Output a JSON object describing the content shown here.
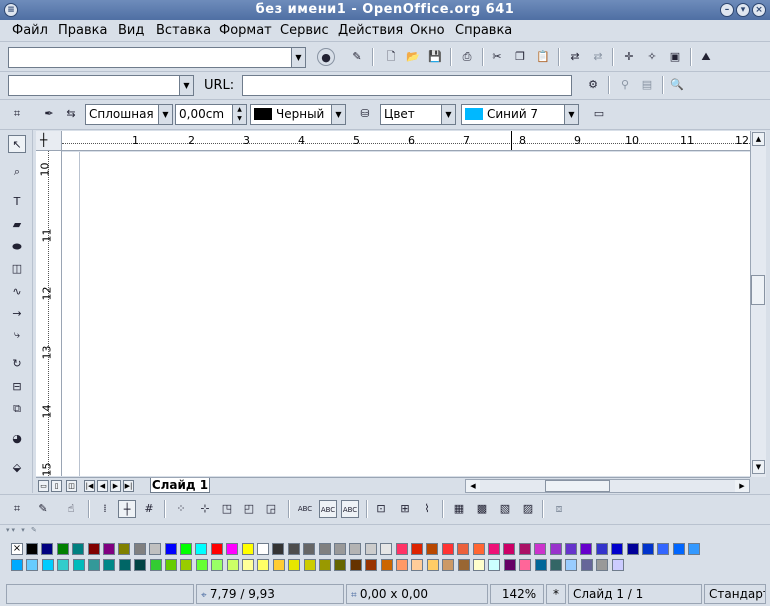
{
  "window": {
    "title": "без имени1 - OpenOffice.org 641"
  },
  "menu": [
    "Файл",
    "Правка",
    "Вид",
    "Вставка",
    "Формат",
    "Сервис",
    "Действия",
    "Окно",
    "Справка"
  ],
  "url_bar": {
    "label": "URL:",
    "value": ""
  },
  "line_props": {
    "style": "Сплошная",
    "width": "0,00cm",
    "color": "Черный",
    "area_type": "Цвет",
    "area_color": "Синий 7"
  },
  "ruler": {
    "h_labels": [
      "1",
      "2",
      "3",
      "4",
      "5",
      "6",
      "7",
      "8",
      "9",
      "10",
      "11",
      "12"
    ],
    "v_labels": [
      "10",
      "11",
      "12",
      "13",
      "14",
      "15"
    ]
  },
  "slide_tab": "Слайд 1",
  "status": {
    "position": "7,79 / 9,93",
    "size": "0,00 x 0,00",
    "zoom": "142%",
    "modified": "*",
    "slide": "Слайд 1 / 1",
    "layout": "Стандарт"
  },
  "palette": {
    "row1": [
      "#000000",
      "#000080",
      "#008000",
      "#008080",
      "#800000",
      "#800080",
      "#808000",
      "#808080",
      "#c0c0c0",
      "#0000ff",
      "#00ff00",
      "#00ffff",
      "#ff0000",
      "#ff00ff",
      "#ffff00",
      "#ffffff",
      "#333333",
      "#4d4d4d",
      "#666666",
      "#808080",
      "#999999",
      "#b3b3b3",
      "#cccccc",
      "#e6e6e6",
      "#ff3366",
      "#dc2300",
      "#b84700",
      "#ff3333",
      "#eb613d",
      "#ff6633",
      "#ee1177",
      "#cc0066",
      "#aa1166",
      "#cc33cc",
      "#9933cc",
      "#6633cc",
      "#6600cc",
      "#3333cc",
      "#0000cc",
      "#000099",
      "#0033cc",
      "#3366ff",
      "#0066ff",
      "#3399ff"
    ],
    "row2": [
      "#00aaff",
      "#66ccff",
      "#00ccff",
      "#33cccc",
      "#00bbbb",
      "#339999",
      "#008888",
      "#006666",
      "#004444",
      "#33cc33",
      "#66cc00",
      "#99cc00",
      "#66ff33",
      "#99ff66",
      "#ccff66",
      "#ffff99",
      "#ffff66",
      "#ffcc33",
      "#e6e600",
      "#cccc00",
      "#999900",
      "#666600",
      "#663300",
      "#993300",
      "#cc6600",
      "#ff9966",
      "#ffcc99",
      "#ffcc66",
      "#cc9966",
      "#996633",
      "#ffffcc",
      "#ccffff",
      "#660066",
      "#ff6699",
      "#006699",
      "#336666",
      "#99ccff",
      "#666699",
      "#999999",
      "#ccccff"
    ]
  },
  "icons": {
    "standard": [
      "open-url-icon",
      "edit-file-icon",
      "new-doc-icon",
      "open-folder-icon",
      "save-icon",
      "print-icon",
      "cut-icon",
      "copy-icon",
      "paste-icon",
      "undo-icon",
      "redo-icon",
      "navigator-icon",
      "stylist-icon",
      "gallery-icon",
      "image-icon"
    ],
    "left_tools": [
      "select-icon",
      "zoom-icon",
      "text-icon",
      "rectangle-icon",
      "ellipse-icon",
      "3d-cube-icon",
      "curve-icon",
      "line-icon",
      "connector-icon",
      "rotate-icon",
      "align-icon",
      "arrange-icon",
      "effects-icon",
      "3d-object-icon"
    ]
  }
}
